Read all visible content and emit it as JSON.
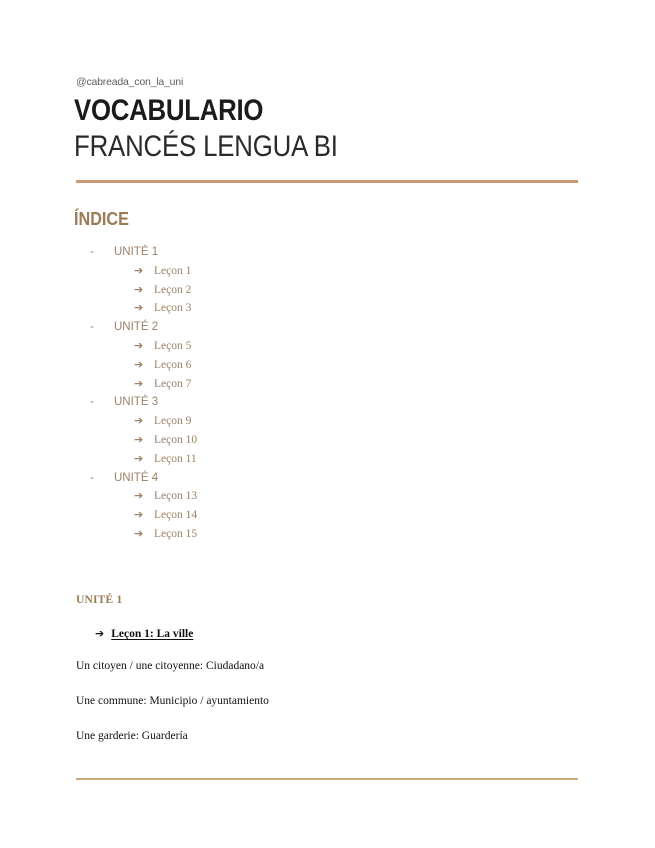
{
  "document": {
    "handle": "@cabreada_con_la_uni",
    "title_main": "VOCABULARIO",
    "title_sub": "FRANCÉS LENGUA BI",
    "accent_color": "#c89b6e",
    "heading_color": "#9a7b55",
    "index_text_color": "#9c8165",
    "body_text_color": "#111111",
    "background": "#ffffff"
  },
  "index": {
    "heading": "ÍNDICE",
    "bullet_dash": "-",
    "arrow": "➔",
    "units": [
      {
        "label": "UNITÉ 1",
        "lessons": [
          "Leçon 1",
          "Leçon 2",
          "Leçon 3"
        ]
      },
      {
        "label": "UNITÉ 2",
        "lessons": [
          "Leçon 5",
          "Leçon 6",
          "Leçon 7"
        ]
      },
      {
        "label": "UNITÉ 3",
        "lessons": [
          "Leçon 9",
          "Leçon 10",
          "Leçon 11"
        ]
      },
      {
        "label": "UNITÉ 4",
        "lessons": [
          "Leçon 13",
          "Leçon 14",
          "Leçon 15"
        ]
      }
    ]
  },
  "body": {
    "unit_heading": "UNITÉ 1",
    "lesson_arrow": "➔",
    "lesson_heading": "Leçon 1: La ville",
    "entries": [
      "Un citoyen / une citoyenne: Ciudadano/a",
      "Une commune: Municipio / ayuntamiento",
      "Une garderie: Guardería"
    ]
  }
}
